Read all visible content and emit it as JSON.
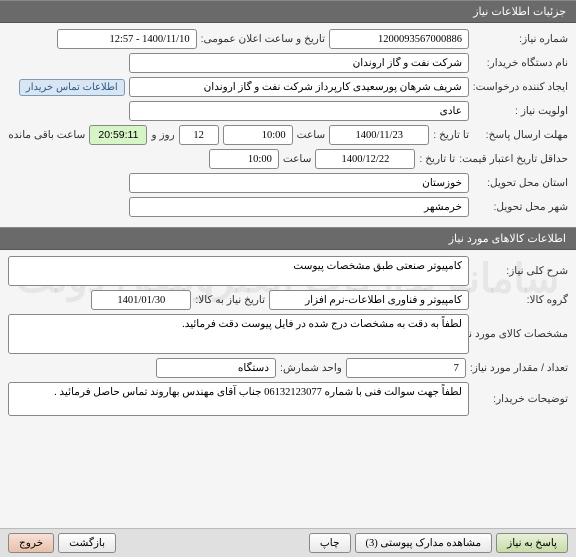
{
  "watermark": "سامانه تدارکات الکترونیکی دولت",
  "header1": "جزئیات اطلاعات نیاز",
  "header2": "اطلاعات کالاهای مورد نیاز",
  "labels": {
    "req_number": "شماره نیاز:",
    "announce_datetime": "تاریخ و ساعت اعلان عمومی:",
    "buyer_org": "نام دستگاه خریدار:",
    "req_creator": "ایجاد کننده درخواست:",
    "buyer_contact_btn": "اطلاعات تماس خریدار",
    "priority": "اولویت نیاز :",
    "reply_deadline": "مهلت ارسال پاسخ:",
    "until_date": "تا تاریخ :",
    "time": "ساعت",
    "days_and": "روز و",
    "time_remaining": "ساعت باقی مانده",
    "price_validity": "حداقل تاریخ اعتبار قیمت:",
    "delivery_province": "استان محل تحویل:",
    "delivery_city": "شهر محل تحویل:",
    "req_title": "شرح کلی نیاز:",
    "goods_group": "گروه کالا:",
    "goods_need_date": "تاریخ نیاز به کالا:",
    "goods_spec": "مشخصات کالای مورد نیاز:",
    "qty": "تعداد / مقدار مورد نیاز:",
    "unit": "واحد شمارش:",
    "buyer_notes": "توضیحات خریدار:"
  },
  "values": {
    "req_number": "1200093567000886",
    "announce_datetime": "1400/11/10 - 12:57",
    "buyer_org": "شرکت نفت و گاز اروندان",
    "req_creator": "شریف شرهان پورسعیدی کارپرداز شرکت نفت و گاز اروندان",
    "priority": "عادی",
    "reply_until_date": "1400/11/23",
    "reply_until_time": "10:00",
    "days_left": "12",
    "clock": "20:59:11",
    "price_until_date": "1400/12/22",
    "price_until_time": "10:00",
    "province": "خوزستان",
    "city": "خرمشهر",
    "req_title": "کامپیوتر صنعتی طبق مشخصات پیوست",
    "goods_group": "کامپیوتر و فناوری اطلاعات-نرم افزار",
    "goods_need_date": "1401/01/30",
    "goods_spec": "لطفاً به دقت به مشخصات درج شده در فایل پیوست دقت فرمائید.",
    "qty": "7",
    "unit": "دستگاه",
    "buyer_notes": "لطفاً جهت سوالت فنی با شماره 06132123077 جناب آقای مهندس بهاروند تماس حاصل فرمائید ."
  },
  "footer": {
    "reply": "پاسخ به نیاز",
    "attachments": "مشاهده مدارک پیوستی (3)",
    "print": "چاپ",
    "back": "بازگشت",
    "exit": "خروج"
  }
}
